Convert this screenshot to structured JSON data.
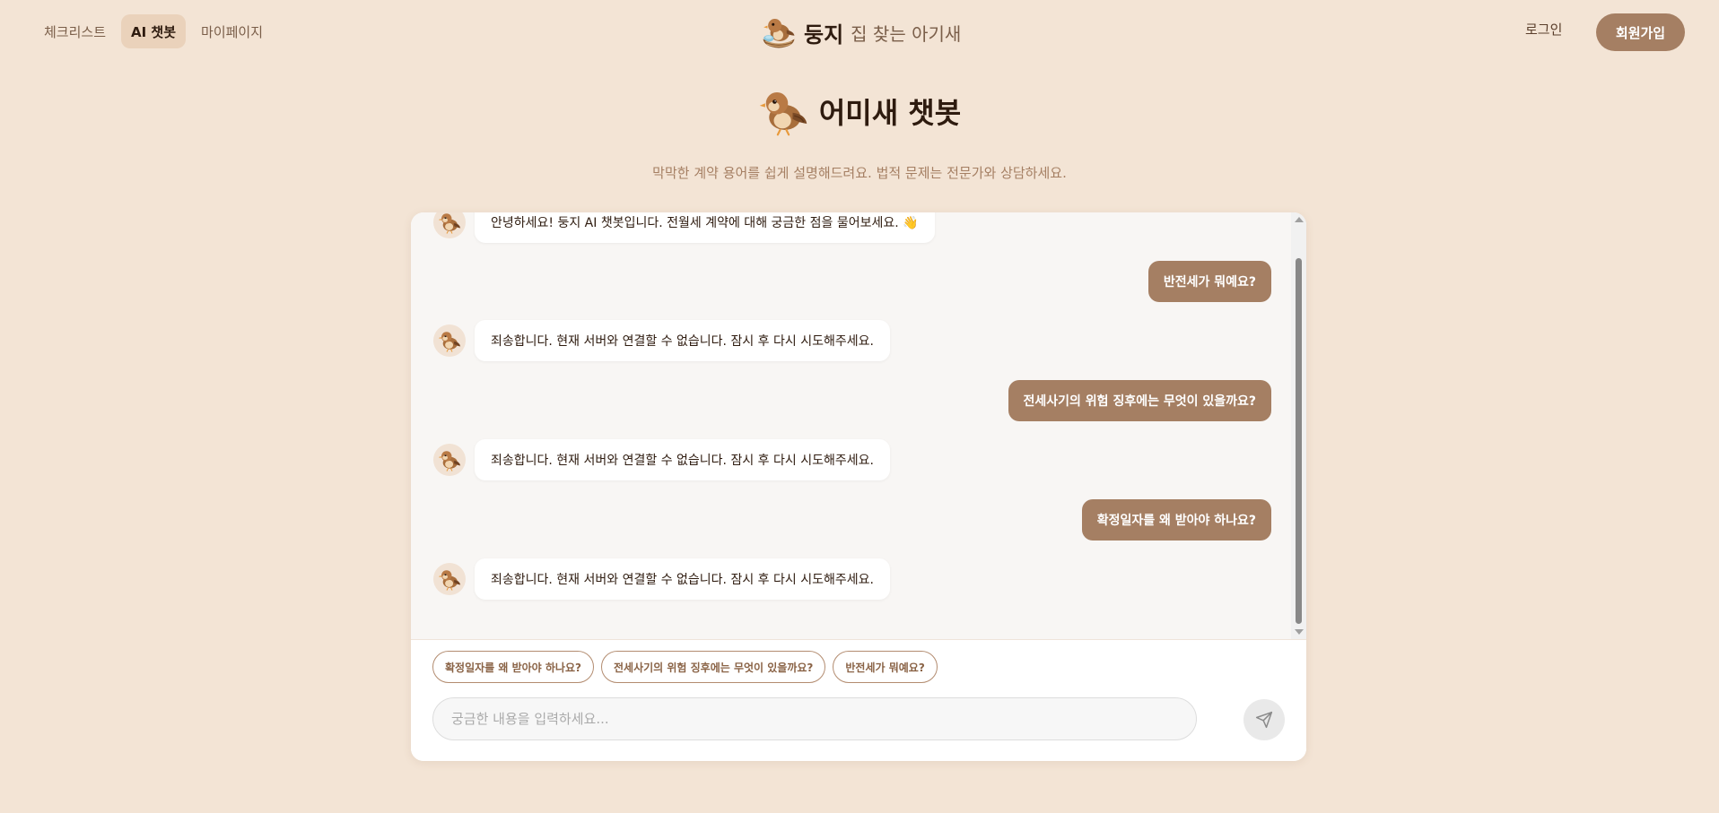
{
  "header": {
    "nav": [
      {
        "label": "체크리스트"
      },
      {
        "label": "AI 챗봇",
        "active": true
      },
      {
        "label": "마이페이지"
      }
    ],
    "brand_name": "둥지",
    "brand_tagline": "집 찾는 아기새",
    "login_label": "로그인",
    "signup_label": "회원가입"
  },
  "hero": {
    "title": "어미새 챗봇",
    "subtitle": "막막한 계약 용어를 쉽게 설명해드려요. 법적 문제는 전문가와 상담하세요."
  },
  "chat": {
    "messages": [
      {
        "role": "bot",
        "text": "안녕하세요! 둥지 AI 챗봇입니다. 전월세 계약에 대해 궁금한 점을 물어보세요. 👋"
      },
      {
        "role": "user",
        "text": "반전세가 뭐예요?"
      },
      {
        "role": "bot",
        "text": "죄송합니다. 현재 서버와 연결할 수 없습니다. 잠시 후 다시 시도해주세요."
      },
      {
        "role": "user",
        "text": "전세사기의 위험 징후에는 무엇이 있을까요?"
      },
      {
        "role": "bot",
        "text": "죄송합니다. 현재 서버와 연결할 수 없습니다. 잠시 후 다시 시도해주세요."
      },
      {
        "role": "user",
        "text": "확정일자를 왜 받아야 하나요?"
      },
      {
        "role": "bot",
        "text": "죄송합니다. 현재 서버와 연결할 수 없습니다. 잠시 후 다시 시도해주세요."
      }
    ],
    "suggestions": [
      "확정일자를 왜 받아야 하나요?",
      "전세사기의 위험 징후에는 무엇이 있을까요?",
      "반전세가 뭐예요?"
    ],
    "input_placeholder": "궁금한 내용을 입력하세요...",
    "input_value": ""
  },
  "icons": {
    "brand": "bird-nest-icon",
    "hero": "sparrow-icon",
    "avatar": "sparrow-icon",
    "send": "send-icon"
  },
  "colors": {
    "background": "#f3e4d5",
    "accent": "#a57f63",
    "text": "#2e1b0f"
  }
}
